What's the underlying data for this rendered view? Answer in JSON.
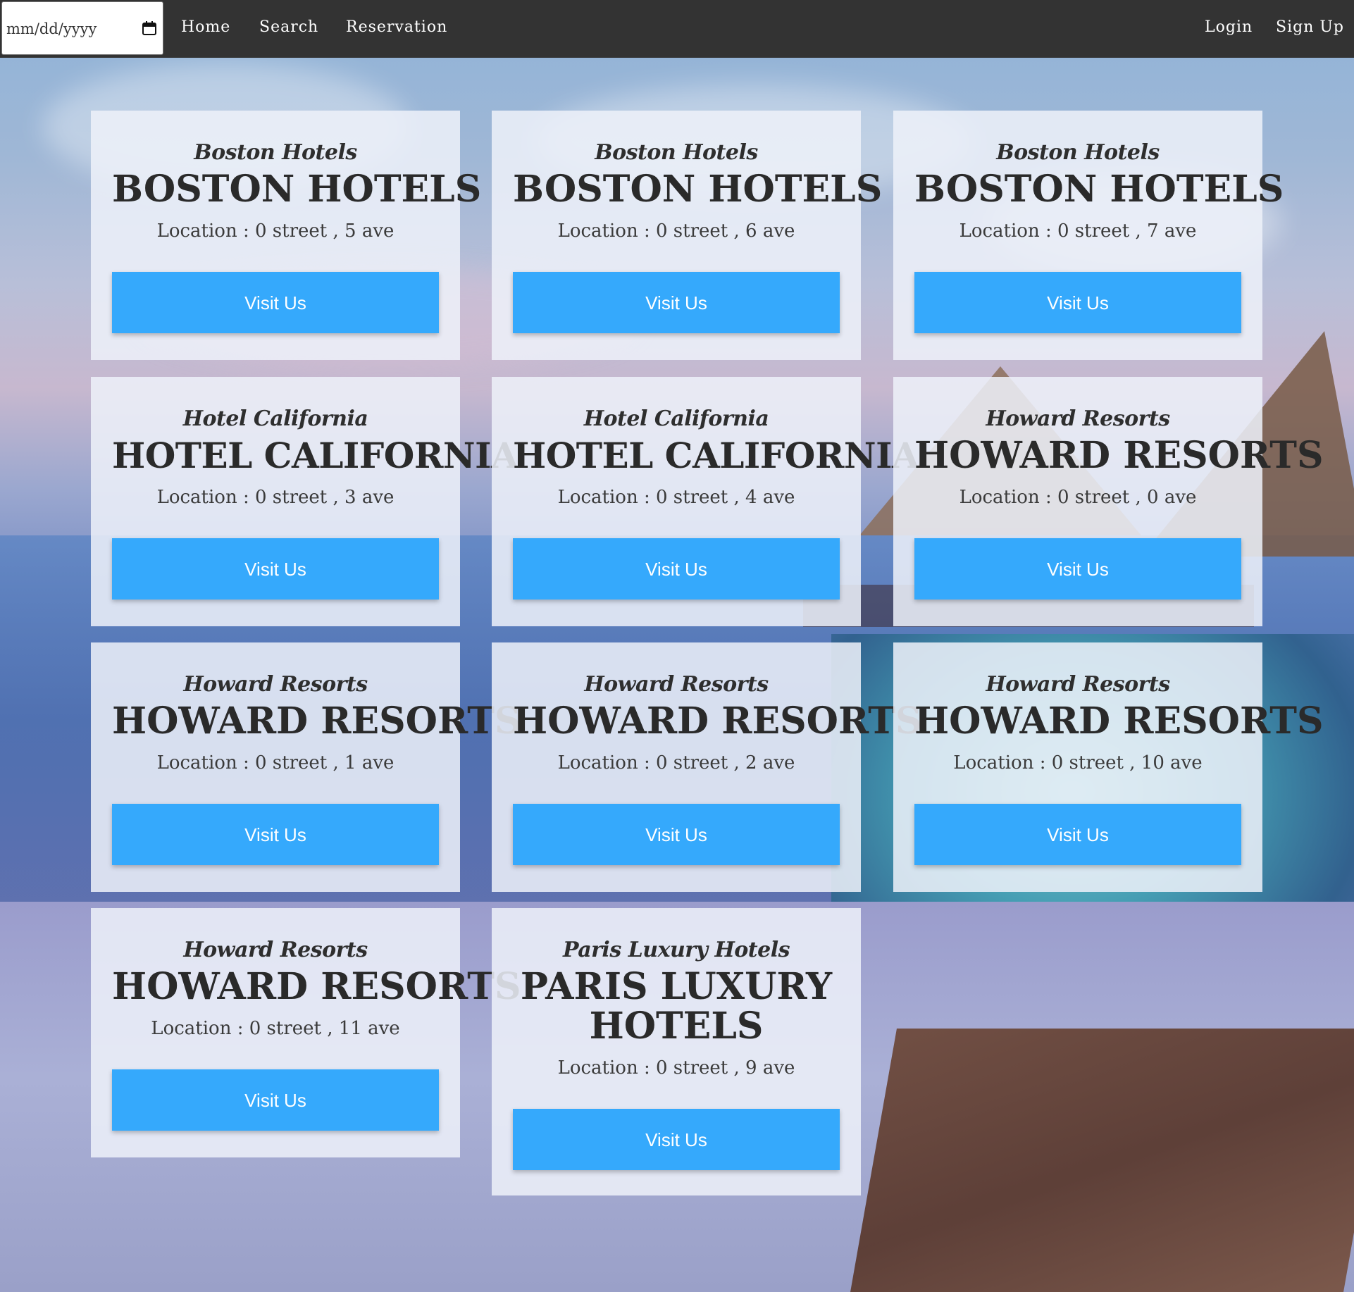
{
  "navbar": {
    "date_placeholder": "mm/dd/yyyy",
    "links": {
      "home": "Home",
      "search": "Search",
      "reservation": "Reservation",
      "login": "Login",
      "signup": "Sign Up"
    },
    "bg_color": "#333333"
  },
  "colors": {
    "button": "#35a9fc",
    "card_bg": "rgba(238,241,249,0.86)"
  },
  "cards": [
    {
      "script": "Boston Hotels",
      "title": "Boston Hotels",
      "location": "Location : 0 street , 5 ave",
      "button": "Visit Us"
    },
    {
      "script": "Boston Hotels",
      "title": "Boston Hotels",
      "location": "Location : 0 street , 6 ave",
      "button": "Visit Us"
    },
    {
      "script": "Boston Hotels",
      "title": "Boston Hotels",
      "location": "Location : 0 street , 7 ave",
      "button": "Visit Us"
    },
    {
      "script": "Hotel California",
      "title": "Hotel California",
      "location": "Location : 0 street , 3 ave",
      "button": "Visit Us"
    },
    {
      "script": "Hotel California",
      "title": "Hotel California",
      "location": "Location : 0 street , 4 ave",
      "button": "Visit Us"
    },
    {
      "script": "Howard Resorts",
      "title": "Howard Resorts",
      "location": "Location : 0 street , 0 ave",
      "button": "Visit Us"
    },
    {
      "script": "Howard Resorts",
      "title": "Howard Resorts",
      "location": "Location : 0 street , 1 ave",
      "button": "Visit Us"
    },
    {
      "script": "Howard Resorts",
      "title": "Howard Resorts",
      "location": "Location : 0 street , 2 ave",
      "button": "Visit Us"
    },
    {
      "script": "Howard Resorts",
      "title": "Howard Resorts",
      "location": "Location : 0 street , 10 ave",
      "button": "Visit Us"
    },
    {
      "script": "Howard Resorts",
      "title": "Howard Resorts",
      "location": "Location : 0 street , 11 ave",
      "button": "Visit Us"
    },
    {
      "script": "Paris Luxury Hotels",
      "title": "Paris Luxury Hotels",
      "location": "Location : 0 street , 9 ave",
      "button": "Visit Us"
    }
  ]
}
